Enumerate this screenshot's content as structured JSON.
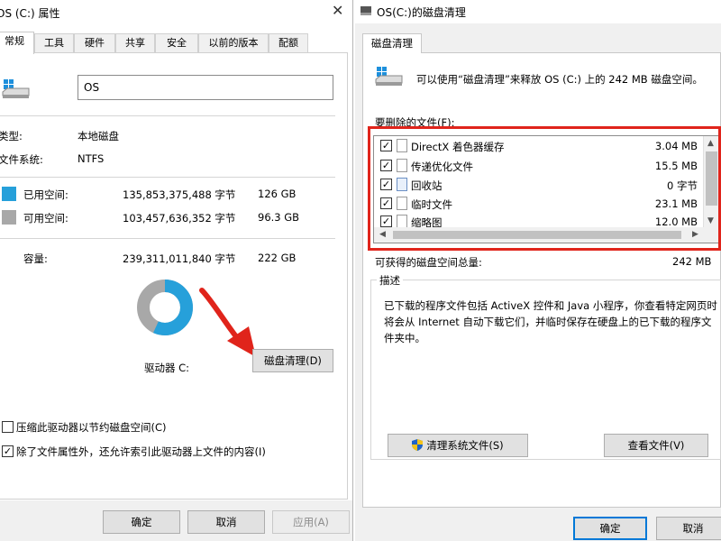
{
  "left_window": {
    "title": "OS (C:) 属性",
    "tabs": [
      "常规",
      "工具",
      "硬件",
      "共享",
      "安全",
      "以前的版本",
      "配额"
    ],
    "drive_name": "OS",
    "type_label": "类型:",
    "type_value": "本地磁盘",
    "fs_label": "文件系统:",
    "fs_value": "NTFS",
    "used_label": "已用空间:",
    "used_bytes": "135,853,375,488 字节",
    "used_gb": "126 GB",
    "free_label": "可用空间:",
    "free_bytes": "103,457,636,352 字节",
    "free_gb": "96.3 GB",
    "capacity_label": "容量:",
    "capacity_bytes": "239,311,011,840 字节",
    "capacity_gb": "222 GB",
    "drive_label": "驱动器 C:",
    "cleanup_button": "磁盘清理(D)",
    "compress_label": "压缩此驱动器以节约磁盘空间(C)",
    "index_label": "除了文件属性外，还允许索引此驱动器上文件的内容(I)",
    "ok": "确定",
    "cancel": "取消",
    "apply": "应用(A)",
    "used_fraction": 0.568,
    "colors": {
      "used": "#26a0da",
      "free": "#a8a8a8"
    }
  },
  "right_window": {
    "title": "OS(C:)的磁盘清理",
    "tab": "磁盘清理",
    "intro": "可以使用“磁盘清理”来释放 OS (C:) 上的 242 MB 磁盘空间。",
    "files_label": "要删除的文件(F):",
    "files": [
      {
        "name": "DirectX 着色器缓存",
        "size": "3.04 MB",
        "checked": true
      },
      {
        "name": "传递优化文件",
        "size": "15.5 MB",
        "checked": true
      },
      {
        "name": "回收站",
        "size": "0 字节",
        "checked": true
      },
      {
        "name": "临时文件",
        "size": "23.1 MB",
        "checked": true
      },
      {
        "name": "缩略图",
        "size": "12.0 MB",
        "checked": true
      }
    ],
    "total_label": "可获得的磁盘空间总量:",
    "total_value": "242 MB",
    "desc_title": "描述",
    "desc_text": "已下载的程序文件包括 ActiveX 控件和 Java 小程序，你查看特定网页时将会从 Internet 自动下载它们，并临时保存在硬盘上的已下载的程序文件夹中。",
    "clean_system_button": "清理系统文件(S)",
    "view_files_button": "查看文件(V)",
    "ok": "确定",
    "cancel": "取消"
  }
}
